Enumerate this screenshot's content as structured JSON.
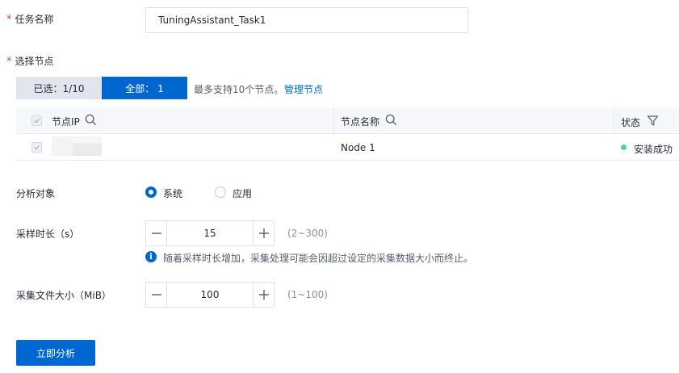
{
  "task_name": {
    "required_mark": "*",
    "label": "任务名称",
    "value": "TuningAssistant_Task1"
  },
  "node_select": {
    "required_mark": "*",
    "label": "选择节点",
    "tab_selected": "已选：1/10",
    "tab_all": "全部： 1",
    "limit_hint": "最多支持10个节点。",
    "manage_link": "管理节点"
  },
  "table": {
    "col_ip": "节点IP",
    "col_name": "节点名称",
    "col_status": "状态",
    "rows": [
      {
        "ip": "",
        "name": "Node 1",
        "status": "安装成功",
        "status_color": "#50d4a0",
        "checked": true
      }
    ]
  },
  "analysis_target": {
    "label": "分析对象",
    "options": [
      "系统",
      "应用"
    ],
    "selected": "系统"
  },
  "sample_duration": {
    "label": "采样时长（s）",
    "value": "15",
    "range": "(2~300)",
    "info": "随着采样时长增加，采集处理可能会因超过设定的采集数据大小而终止。"
  },
  "file_size": {
    "label": "采集文件大小（MiB）",
    "value": "100",
    "range": "(1~100)"
  },
  "submit_label": "立即分析",
  "colors": {
    "primary": "#0067d1",
    "required": "#e54545",
    "success": "#50d4a0"
  }
}
